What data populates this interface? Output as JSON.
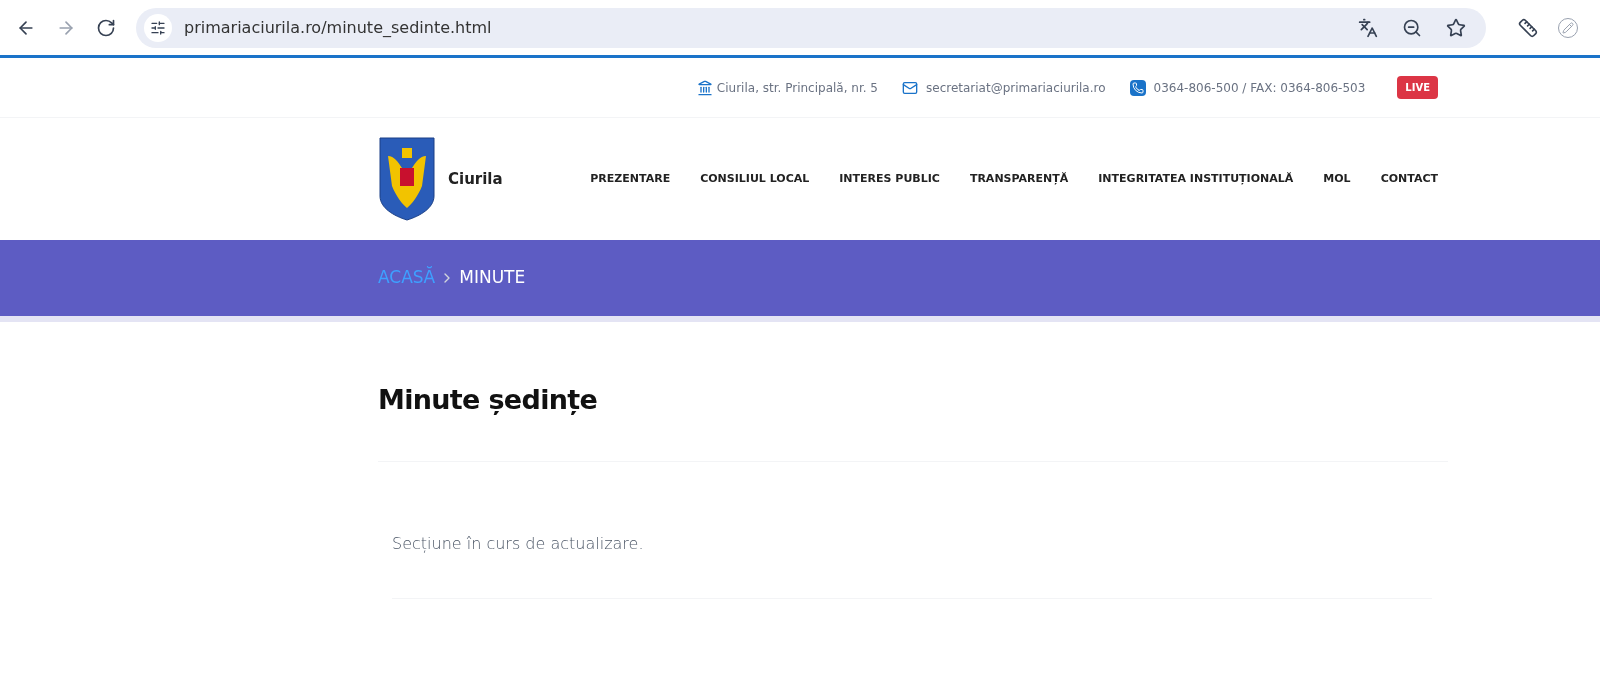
{
  "browser": {
    "url": "primariaciurila.ro/minute_sedinte.html"
  },
  "topbar": {
    "address": "Ciurila, str. Principală, nr. 5",
    "email": "secretariat@primariaciurila.ro",
    "phone": "0364-806-500 / FAX: 0364-806-503",
    "live": "LIVE"
  },
  "header": {
    "site_name": "Ciurila",
    "nav": [
      "PREZENTARE",
      "CONSILIUL LOCAL",
      "INTERES PUBLIC",
      "TRANSPARENȚĂ",
      "INTEGRITATEA INSTITUȚIONALĂ",
      "MOL",
      "CONTACT"
    ]
  },
  "breadcrumb": {
    "items": [
      "ACASĂ",
      "MINUTE"
    ]
  },
  "content": {
    "title": "Minute ședințe",
    "message": "Secțiune în curs de actualizare."
  }
}
